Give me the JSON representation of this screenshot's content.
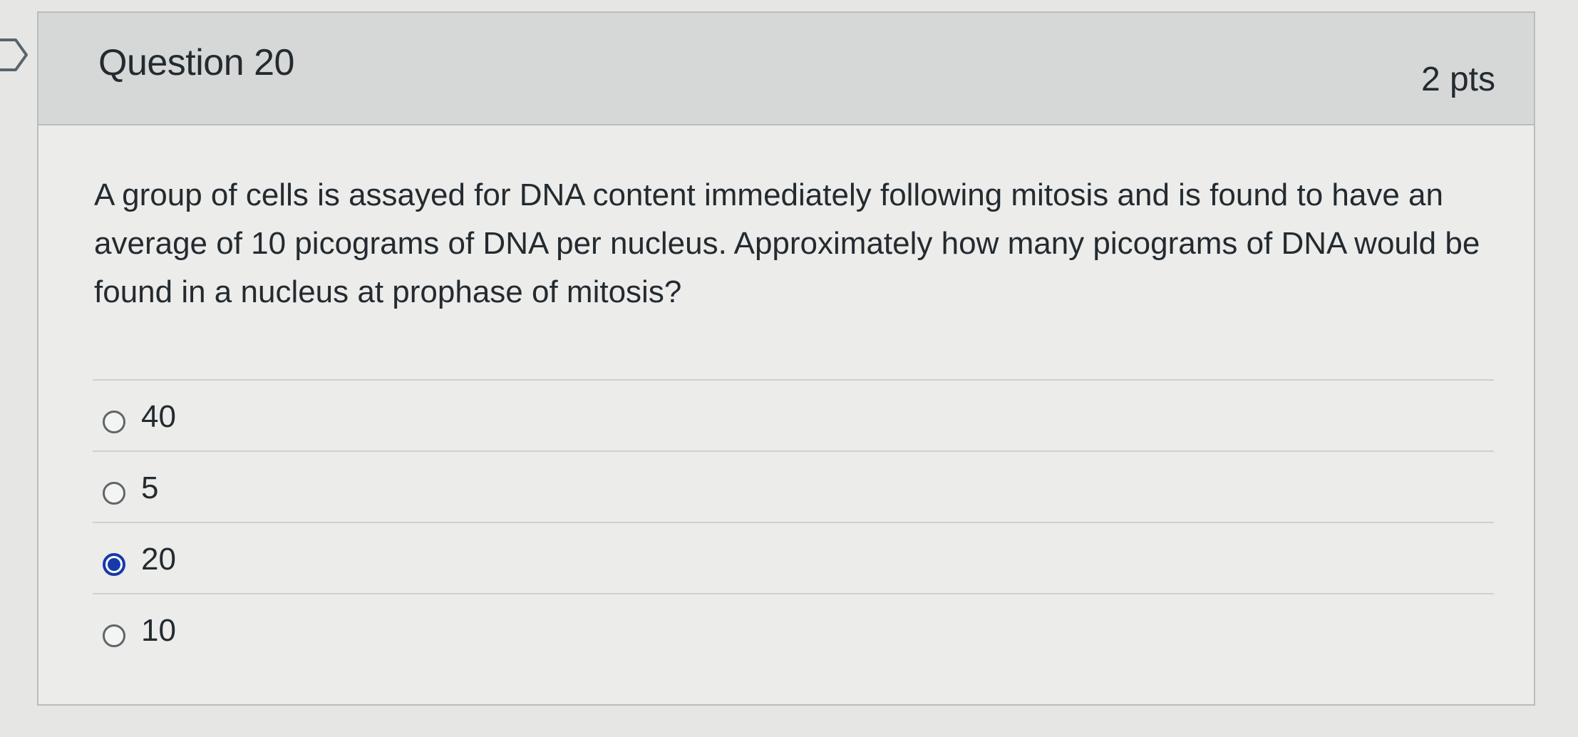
{
  "question": {
    "title": "Question 20",
    "points": "2 pts",
    "text": "A group of cells is assayed for DNA content immediately following mitosis and is found to have an average of 10 picograms of DNA per nucleus. Approximately how many picograms of DNA would be found in a nucleus at prophase of mitosis?",
    "answers": [
      {
        "label": "40",
        "selected": false
      },
      {
        "label": "5",
        "selected": false
      },
      {
        "label": "20",
        "selected": true
      },
      {
        "label": "10",
        "selected": false
      }
    ]
  },
  "icons": {
    "left_marker": "flag-icon"
  },
  "colors": {
    "selected_radio": "#163aa8",
    "header_background": "#d6d8d7",
    "card_border": "#b9bcbd"
  }
}
